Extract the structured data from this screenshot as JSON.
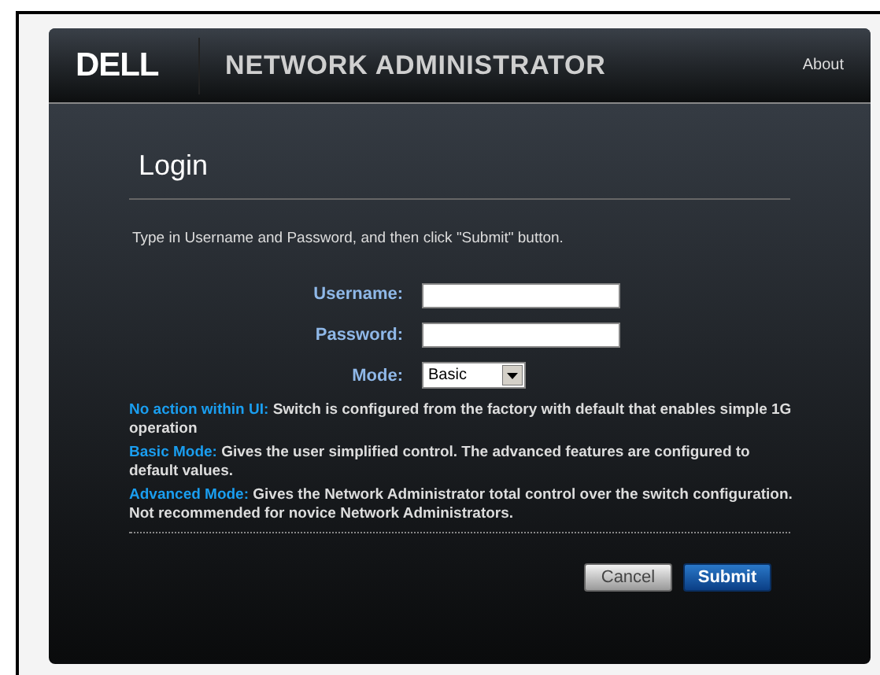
{
  "header": {
    "logo": "DELL",
    "title": "NETWORK ADMINISTRATOR",
    "about_link": "About"
  },
  "login": {
    "title": "Login",
    "instruction": "Type in Username and Password, and then click \"Submit\" button.",
    "fields": [
      {
        "kind": "text",
        "label": "Username:"
      },
      {
        "kind": "password",
        "label": "Password:"
      },
      {
        "kind": "select",
        "label": "Mode:",
        "value": "Basic"
      }
    ],
    "modes": [
      {
        "name": "No action within UI:",
        "description": "Switch is configured from the factory with default that enables simple 1G operation"
      },
      {
        "name": "Basic Mode:",
        "description": "Gives the user simplified control. The advanced features are configured to default values."
      },
      {
        "name": "Advanced Mode:",
        "description": "Gives the Network Administrator total control over the switch configuration. Not recommended for novice Network Administrators."
      }
    ],
    "buttons": [
      {
        "kind": "secondary",
        "label": "Cancel"
      },
      {
        "kind": "primary",
        "label": "Submit"
      }
    ]
  }
}
